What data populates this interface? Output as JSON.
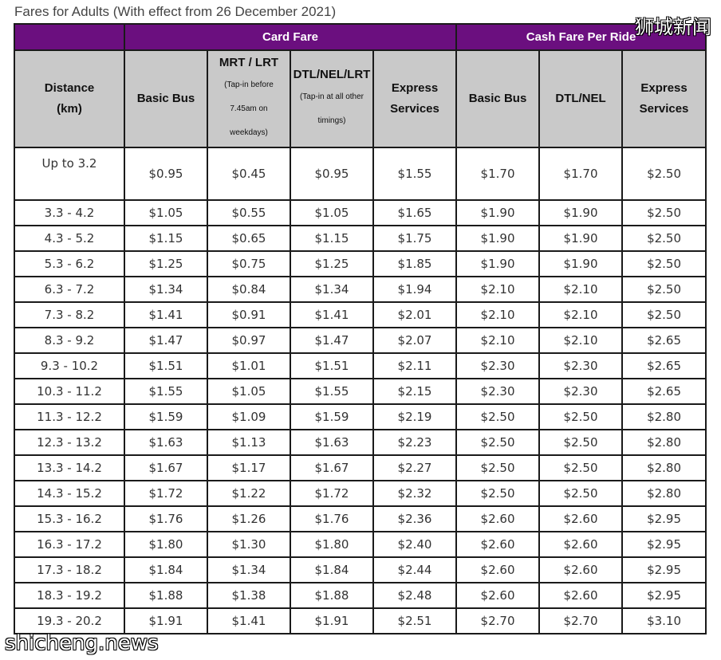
{
  "caption": "Fares for Adults (With effect from 26 December 2021)",
  "watermarks": {
    "top_right": "狮城新闻",
    "bottom_left": "shicheng.news"
  },
  "header": {
    "card_fare": "Card Fare",
    "cash_fare": "Cash Fare Per Ride",
    "distance": [
      "Distance",
      "(km)"
    ],
    "basic_bus": "Basic Bus",
    "mrt_lrt": "MRT / LRT",
    "mrt_lrt_note": [
      "(Tap-in before",
      "7.45am on",
      "weekdays)"
    ],
    "dtl_nel_lrt": "DTL/NEL/LRT",
    "dtl_nel_lrt_note": [
      "(Tap-in at all other",
      "timings)"
    ],
    "express": [
      "Express",
      "Services"
    ],
    "cash_basic_bus": "Basic Bus",
    "cash_dtl_nel": "DTL/NEL",
    "cash_express": [
      "Express",
      "Services"
    ]
  },
  "colors": {
    "header_purple": "#6b0f7f",
    "subheader_grey": "#c9c9c9"
  },
  "rows": [
    [
      "Up to 3.2",
      "$0.95",
      "$0.45",
      "$0.95",
      "$1.55",
      "$1.70",
      "$1.70",
      "$2.50"
    ],
    [
      "3.3 - 4.2",
      "$1.05",
      "$0.55",
      "$1.05",
      "$1.65",
      "$1.90",
      "$1.90",
      "$2.50"
    ],
    [
      "4.3 - 5.2",
      "$1.15",
      "$0.65",
      "$1.15",
      "$1.75",
      "$1.90",
      "$1.90",
      "$2.50"
    ],
    [
      "5.3 - 6.2",
      "$1.25",
      "$0.75",
      "$1.25",
      "$1.85",
      "$1.90",
      "$1.90",
      "$2.50"
    ],
    [
      "6.3 - 7.2",
      "$1.34",
      "$0.84",
      "$1.34",
      "$1.94",
      "$2.10",
      "$2.10",
      "$2.50"
    ],
    [
      "7.3 - 8.2",
      "$1.41",
      "$0.91",
      "$1.41",
      "$2.01",
      "$2.10",
      "$2.10",
      "$2.50"
    ],
    [
      "8.3 - 9.2",
      "$1.47",
      "$0.97",
      "$1.47",
      "$2.07",
      "$2.10",
      "$2.10",
      "$2.65"
    ],
    [
      "9.3 - 10.2",
      "$1.51",
      "$1.01",
      "$1.51",
      "$2.11",
      "$2.30",
      "$2.30",
      "$2.65"
    ],
    [
      "10.3 - 11.2",
      "$1.55",
      "$1.05",
      "$1.55",
      "$2.15",
      "$2.30",
      "$2.30",
      "$2.65"
    ],
    [
      "11.3 - 12.2",
      "$1.59",
      "$1.09",
      "$1.59",
      "$2.19",
      "$2.50",
      "$2.50",
      "$2.80"
    ],
    [
      "12.3 - 13.2",
      "$1.63",
      "$1.13",
      "$1.63",
      "$2.23",
      "$2.50",
      "$2.50",
      "$2.80"
    ],
    [
      "13.3 - 14.2",
      "$1.67",
      "$1.17",
      "$1.67",
      "$2.27",
      "$2.50",
      "$2.50",
      "$2.80"
    ],
    [
      "14.3 - 15.2",
      "$1.72",
      "$1.22",
      "$1.72",
      "$2.32",
      "$2.50",
      "$2.50",
      "$2.80"
    ],
    [
      "15.3 - 16.2",
      "$1.76",
      "$1.26",
      "$1.76",
      "$2.36",
      "$2.60",
      "$2.60",
      "$2.95"
    ],
    [
      "16.3 - 17.2",
      "$1.80",
      "$1.30",
      "$1.80",
      "$2.40",
      "$2.60",
      "$2.60",
      "$2.95"
    ],
    [
      "17.3 - 18.2",
      "$1.84",
      "$1.34",
      "$1.84",
      "$2.44",
      "$2.60",
      "$2.60",
      "$2.95"
    ],
    [
      "18.3 - 19.2",
      "$1.88",
      "$1.38",
      "$1.88",
      "$2.48",
      "$2.60",
      "$2.60",
      "$2.95"
    ],
    [
      "19.3 - 20.2",
      "$1.91",
      "$1.41",
      "$1.91",
      "$2.51",
      "$2.70",
      "$2.70",
      "$3.10"
    ]
  ]
}
